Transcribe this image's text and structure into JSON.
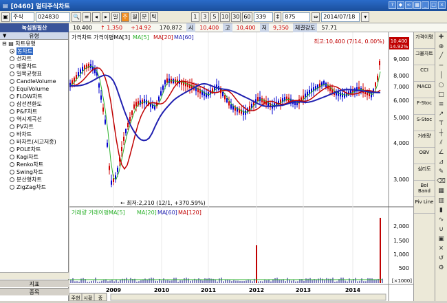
{
  "window": {
    "title": "[0460] 멀티주식차트"
  },
  "toolbar": {
    "market": "주식",
    "code": "024830",
    "period_buttons": [
      "일",
      "주",
      "월",
      "분",
      "틱"
    ],
    "active_period": "주",
    "interval_buttons": [
      "1",
      "3",
      "5",
      "10",
      "30",
      "60"
    ],
    "count_value": "339",
    "total_value": "875",
    "date_value": "2014/07/18"
  },
  "infobar": {
    "name": "녹십원필산",
    "price": "10,400",
    "change": "↑ 1,350",
    "change_pct": "+14.92",
    "volume": "170,872",
    "open_label": "시",
    "open": "10,400",
    "high_label": "고",
    "high": "10,400",
    "low_label": "저",
    "low": "9,350",
    "strength_label": "체결강도",
    "strength": "57.71"
  },
  "left_panel": {
    "header": "유형",
    "root": "차트유형",
    "items": [
      "봉차트",
      "선차트",
      "매물차트",
      "일목균형표",
      "CandleVolume",
      "EquiVolume",
      "FLOW차트",
      "삼선전환도",
      "P&F차트",
      "역시계곡선",
      "PV차트",
      "바차트",
      "바차트(시고저종)",
      "POLE차트",
      "Kagi차트",
      "Renko차트",
      "Swing차트",
      "분산형차트",
      "ZigZag차트"
    ],
    "selected_index": 0,
    "footer1": "지표",
    "footer2": "종목"
  },
  "price_chart": {
    "legend_title": "가격차트 가격이평MA[3]",
    "legend_ma": [
      "MA[5]",
      "MA[20]",
      "MA[60]"
    ],
    "legend_colors": [
      "#2ab02a",
      "#c00000",
      "#2020b0"
    ],
    "y_ticks": [
      "9,000",
      "8,000",
      "7,000",
      "6,000",
      "5,000",
      "4,000",
      "3,000"
    ],
    "max_annotation": "최고:10,400 (7/14, 0.00%)",
    "min_annotation": "최저:2,210 (12/1, +370.59%)",
    "price_tag": "10,400",
    "price_tag_pct": "14.92%"
  },
  "volume_chart": {
    "legend_title": "거래량 거래이평MA[5]",
    "legend_ma": [
      "MA[20]",
      "MA[60]",
      "MA[120]"
    ],
    "y_ticks": [
      "2,000",
      "1,500",
      "1,000",
      "500"
    ],
    "unit": "[×1000]"
  },
  "x_axis": {
    "labels": [
      "2009",
      "2010",
      "2011",
      "2012",
      "2013",
      "2014"
    ]
  },
  "bottom_tabs": [
    "주현",
    "시황",
    "종"
  ],
  "right_toolbar": [
    "가격이평",
    "그물차트",
    "CCI",
    "MACD",
    "F-Stoc",
    "S-Stoc",
    "거래량",
    "OBV",
    "심리도",
    "Bol Band",
    "Piv Line"
  ]
}
